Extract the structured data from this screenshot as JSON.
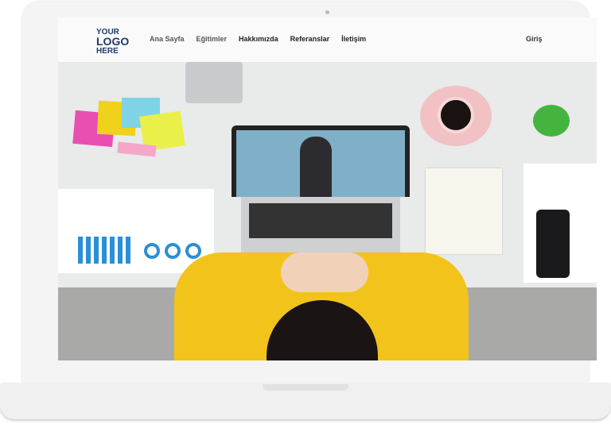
{
  "nav": {
    "logo": {
      "line1": "YOUR",
      "line2": "LOGO",
      "line3": "HERE"
    },
    "items": [
      "Ana Sayfa",
      "Eğitimler",
      "Hakkımızda",
      "Referanslar",
      "İletişim"
    ],
    "login": "Giriş"
  },
  "colors": {
    "logo": "#1e3a6a",
    "sweater": "#f2c41b",
    "background": "#e9eaea"
  }
}
